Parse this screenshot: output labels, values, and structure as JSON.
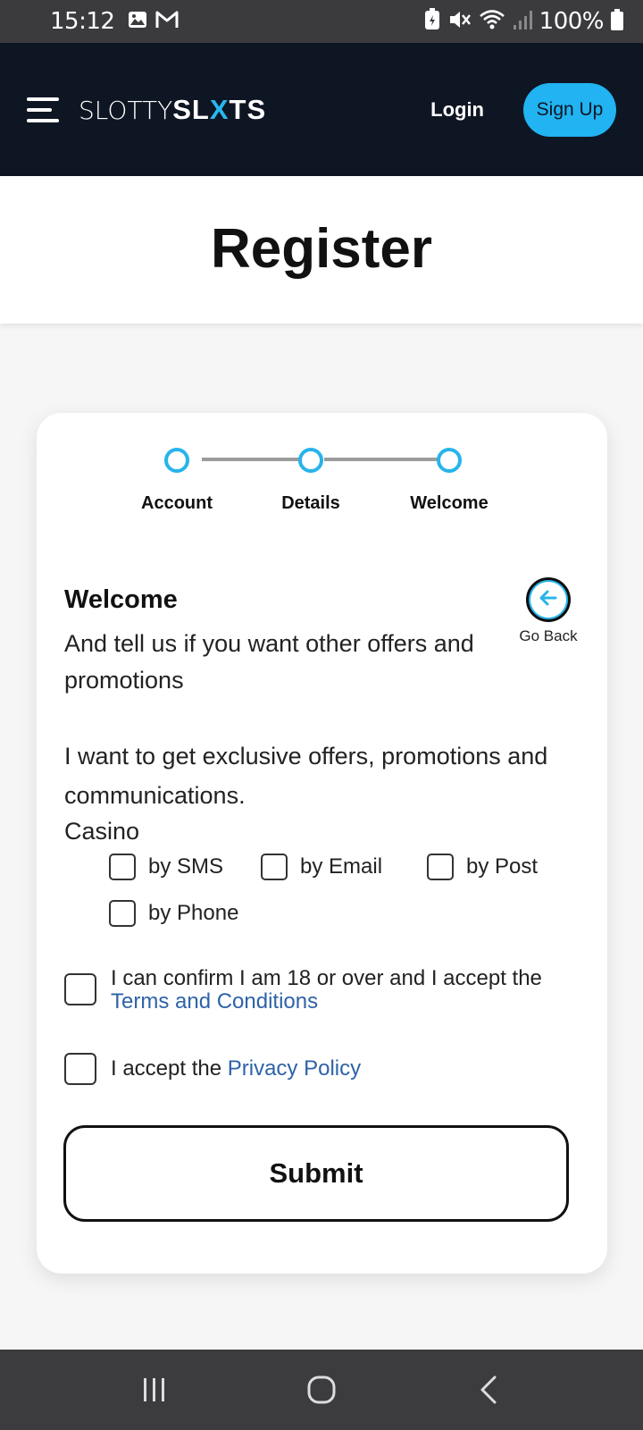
{
  "status_bar": {
    "time": "15:12",
    "left_icons": [
      "gallery-icon",
      "gmail-icon"
    ],
    "right_icons": [
      "battery-saver-icon",
      "mute-icon",
      "wifi-icon",
      "signal-icon"
    ],
    "battery": "100%"
  },
  "header": {
    "logo_thin": "SLOTTY",
    "logo_bold_1": "SL",
    "logo_x": "X",
    "logo_bold_2": "TS",
    "login": "Login",
    "signup": "Sign Up",
    "accent_color": "#21b3f2",
    "bg_color": "#0f1623"
  },
  "page": {
    "title": "Register"
  },
  "stepper": {
    "steps": [
      {
        "label": "Account"
      },
      {
        "label": "Details"
      },
      {
        "label": "Welcome"
      }
    ],
    "current": 3
  },
  "form": {
    "heading": "Welcome",
    "subheading": "And tell us if you want other offers and promotions",
    "go_back": "Go Back",
    "offers_text": "I want to get exclusive offers, promotions and communications.",
    "casino_label": "Casino",
    "options": [
      {
        "label": "by SMS",
        "checked": false
      },
      {
        "label": "by Email",
        "checked": false
      },
      {
        "label": "by Post",
        "checked": false
      },
      {
        "label": "by Phone",
        "checked": false
      }
    ],
    "terms_text": "I can confirm I am 18 or over and I accept the",
    "terms_link": "Terms and Conditions",
    "terms_checked": false,
    "privacy_text": "I accept the",
    "privacy_link": "Privacy Policy",
    "privacy_checked": false,
    "submit": "Submit"
  },
  "nav_bar": {
    "buttons": [
      "recent-apps-icon",
      "home-icon",
      "back-icon"
    ]
  }
}
